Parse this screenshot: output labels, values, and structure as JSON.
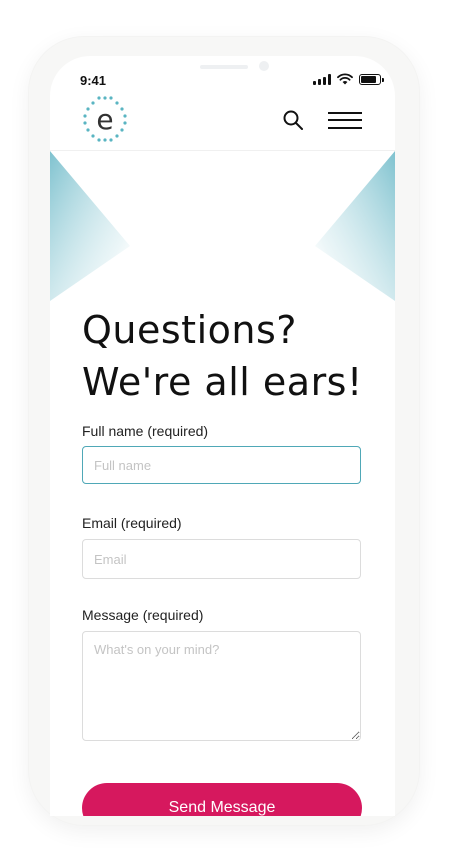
{
  "status_bar": {
    "time": "9:41"
  },
  "brand": {
    "logo_letter": "e",
    "accent": "#4fa8b7",
    "cta_color": "#d6185e"
  },
  "header": {
    "search_icon": "search-icon",
    "menu_icon": "hamburger-menu-icon"
  },
  "page": {
    "title_line1": "Questions?",
    "title_line2": "We're all ears!"
  },
  "form": {
    "full_name": {
      "label": "Full name (required)",
      "placeholder": "Full name",
      "value": ""
    },
    "email": {
      "label": "Email  (required)",
      "placeholder": "Email",
      "value": ""
    },
    "message": {
      "label": "Message  (required)",
      "placeholder": "What's on your mind?",
      "value": ""
    },
    "submit_label": "Send Message"
  }
}
